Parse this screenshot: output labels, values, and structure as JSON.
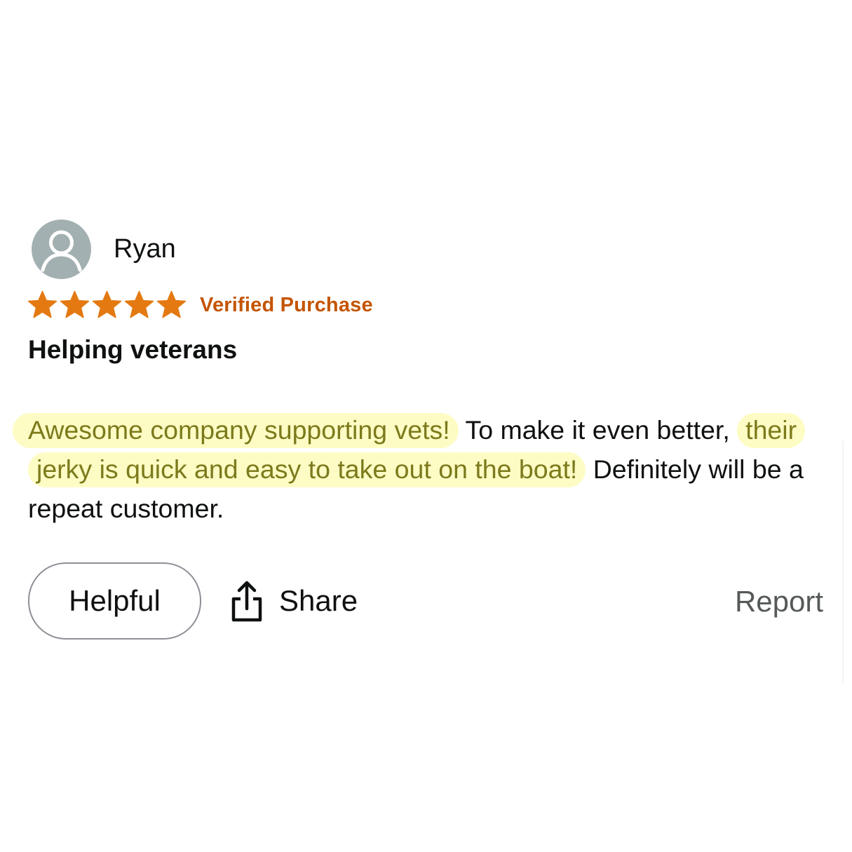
{
  "review": {
    "reviewer_name": "Ryan",
    "rating": {
      "value": 5,
      "max": 5
    },
    "verified_label": "Verified Purchase",
    "title": "Helping veterans",
    "body": {
      "highlight_1": "Awesome company supporting vets!",
      "plain_1": " To make it even better,",
      "highlight_2": "their jerky is quick and easy to take out on the boat!",
      "plain_2": " Definitely will be a repeat customer."
    }
  },
  "actions": {
    "helpful_label": "Helpful",
    "share_label": "Share",
    "report_label": "Report"
  },
  "icons": {
    "avatar": "user-silhouette-icon",
    "star": "star-icon",
    "share": "share-icon"
  },
  "colors": {
    "star": "#e47911",
    "verified": "#c45500",
    "highlight_bg": "#fdfcc4",
    "highlight_text": "#7c7a1c",
    "text": "#0f1111",
    "muted": "#565959",
    "avatar_bg": "#a3b0b1"
  }
}
